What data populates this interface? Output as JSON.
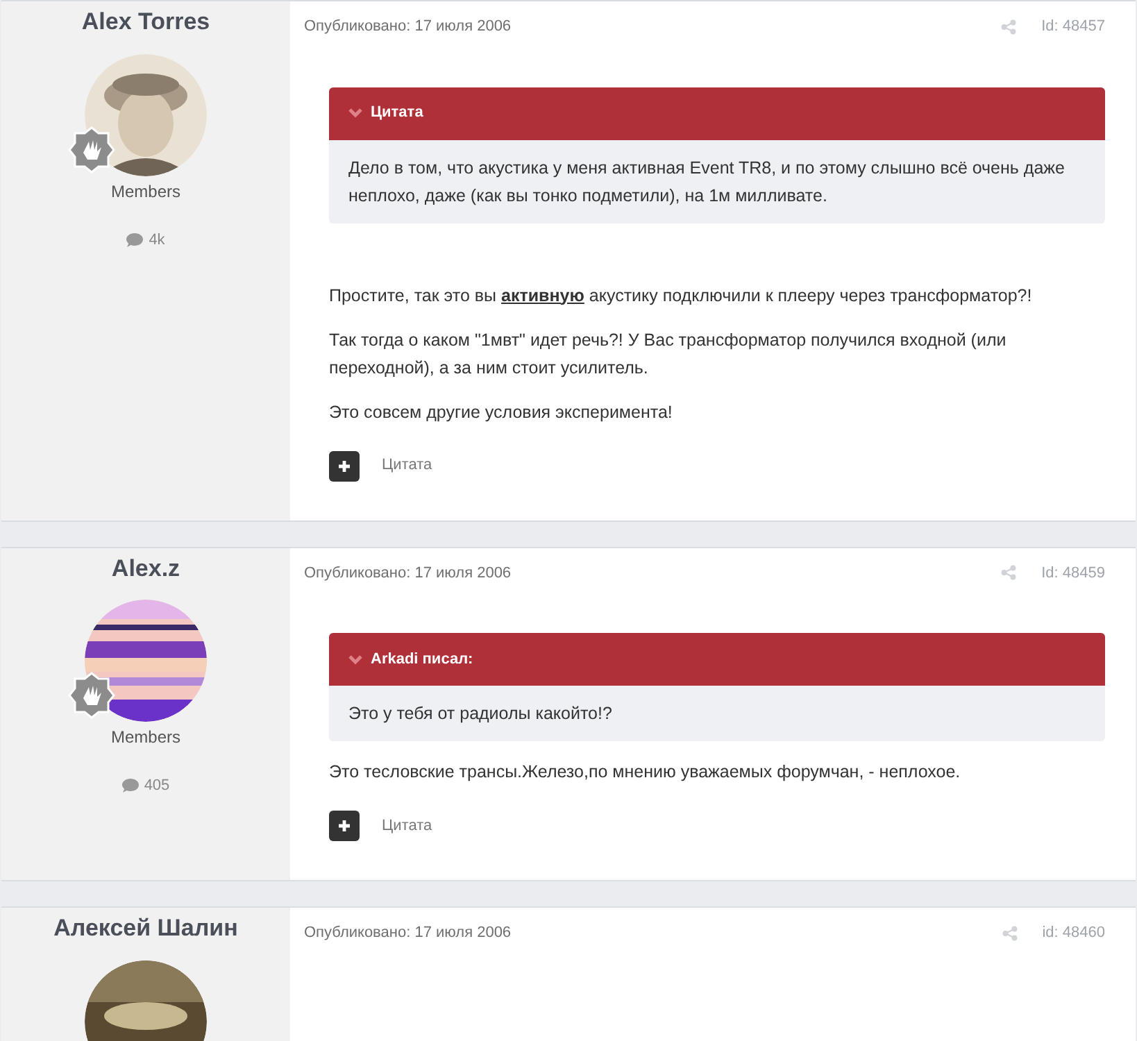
{
  "posts": [
    {
      "author": "Alex Torres",
      "group": "Members",
      "post_count": "4k",
      "date": "Опубликовано: 17 июля 2006",
      "post_id": "Id: 48457",
      "quote": {
        "title": "Цитата",
        "text": "Дело в том, что акустика у меня активная Event TR8, и по этому слышно всё очень даже неплохо, даже (как вы тонко подметили), на 1м милливате."
      },
      "paragraphs": [
        "Простите, так это вы **активную** акустику подключили к плееру через трансформатор?!",
        "Так тогда о каком \"1мвт\" идет речь?! У Вас трансформатор получился входной (или переходной), а за ним стоит усилитель.",
        "Это совсем другие условия эксперимента!"
      ],
      "quote_button": "Цитата"
    },
    {
      "author": "Alex.z",
      "group": "Members",
      "post_count": "405",
      "date": "Опубликовано: 17 июля 2006",
      "post_id": "Id: 48459",
      "quote": {
        "title": "Arkadi писал:",
        "text": "Это у тебя от радиолы какойто!?"
      },
      "paragraphs": [
        "Это тесловские трансы.Железо,по мнению уважаемых форумчан, - неплохое."
      ],
      "quote_button": "Цитата"
    },
    {
      "author": "Алексей Шалин",
      "date": "Опубликовано: 17 июля 2006",
      "post_id": "id: 48460"
    }
  ]
}
